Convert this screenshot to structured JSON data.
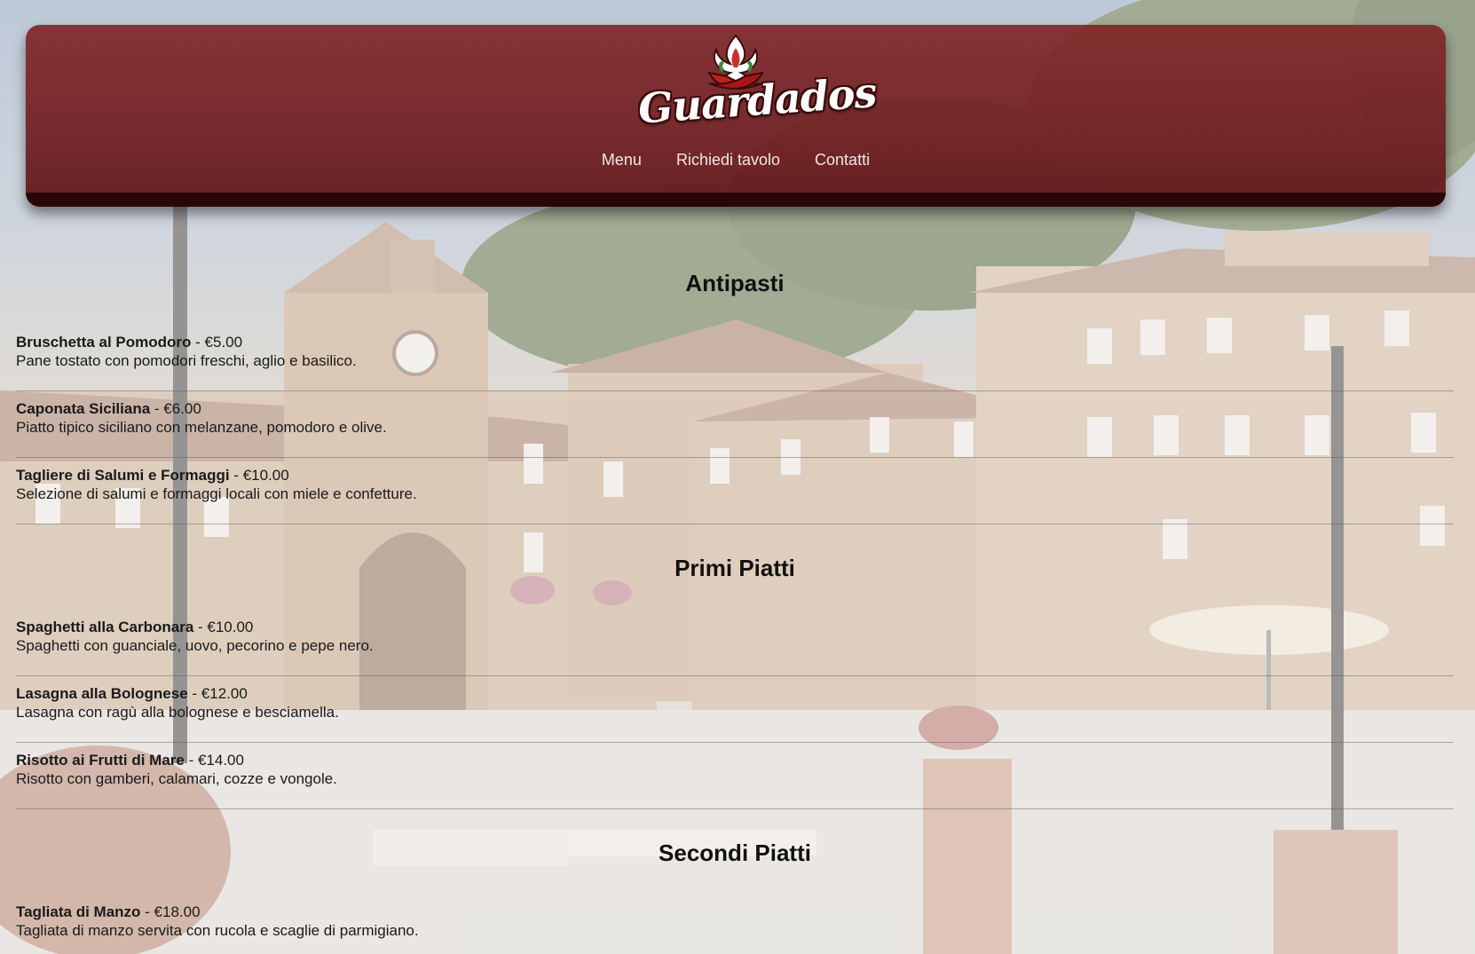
{
  "brand": {
    "name": "Guardados",
    "logo_icon": "chili-pepper-flame-icon",
    "color": "#7f2628"
  },
  "nav": {
    "items": [
      {
        "label": "Menu"
      },
      {
        "label": "Richiedi tavolo"
      },
      {
        "label": "Contatti"
      }
    ]
  },
  "menu": {
    "sections": [
      {
        "title": "Antipasti",
        "items": [
          {
            "name": "Bruschetta al Pomodoro",
            "price": "€5.00",
            "description": "Pane tostato con pomodori freschi, aglio e basilico."
          },
          {
            "name": "Caponata Siciliana",
            "price": "€6.00",
            "description": "Piatto tipico siciliano con melanzane, pomodoro e olive."
          },
          {
            "name": "Tagliere di Salumi e Formaggi",
            "price": "€10.00",
            "description": "Selezione di salumi e formaggi locali con miele e confetture."
          }
        ]
      },
      {
        "title": "Primi Piatti",
        "items": [
          {
            "name": "Spaghetti alla Carbonara",
            "price": "€10.00",
            "description": "Spaghetti con guanciale, uovo, pecorino e pepe nero."
          },
          {
            "name": "Lasagna alla Bolognese",
            "price": "€12.00",
            "description": "Lasagna con ragù alla bolognese e besciamella."
          },
          {
            "name": "Risotto ai Frutti di Mare",
            "price": "€14.00",
            "description": "Risotto con gamberi, calamari, cozze e vongole."
          }
        ]
      },
      {
        "title": "Secondi Piatti",
        "items": [
          {
            "name": "Tagliata di Manzo",
            "price": "€18.00",
            "description": "Tagliata di manzo servita con rucola e scaglie di parmigiano."
          }
        ]
      }
    ]
  }
}
